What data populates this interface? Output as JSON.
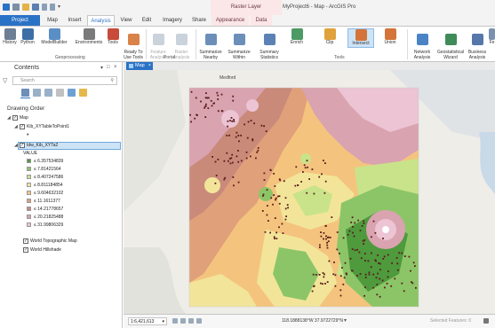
{
  "window": {
    "title": "MyProject6 - Map - ArcGIS Pro",
    "contextual_group": "Raster Layer"
  },
  "tabs": [
    {
      "label": "Project"
    },
    {
      "label": "Map"
    },
    {
      "label": "Insert"
    },
    {
      "label": "Analysis"
    },
    {
      "label": "View"
    },
    {
      "label": "Edit"
    },
    {
      "label": "Imagery"
    },
    {
      "label": "Share"
    },
    {
      "label": "Appearance"
    },
    {
      "label": "Data"
    }
  ],
  "ribbon": {
    "geoprocessing": {
      "label": "Geoprocessing",
      "buttons": [
        {
          "label": "History",
          "icon": "history-icon"
        },
        {
          "label": "Python",
          "icon": "python-icon"
        },
        {
          "label": "ModelBuilder",
          "icon": "modelbuilder-icon"
        },
        {
          "label": "Environments",
          "icon": "environments-icon"
        },
        {
          "label": "Tools",
          "icon": "toolbox-icon"
        },
        {
          "label": "Ready To\nUse Tools",
          "icon": "ready-tools-icon"
        }
      ]
    },
    "portal": {
      "label": "Portal",
      "buttons": [
        {
          "label": "Feature\nAnalysis",
          "icon": "feature-analysis-icon"
        },
        {
          "label": "Raster\nAnalysis",
          "icon": "raster-analysis-icon"
        }
      ]
    },
    "tools": {
      "label": "Tools",
      "buttons": [
        {
          "label": "Summarize\nNearby",
          "icon": "summarize-nearby-icon"
        },
        {
          "label": "Summarize\nWithin",
          "icon": "summarize-within-icon"
        },
        {
          "label": "Summary\nStatistics",
          "icon": "summary-statistics-icon"
        },
        {
          "label": "Enrich",
          "icon": "enrich-icon"
        },
        {
          "label": "Clip",
          "icon": "clip-icon"
        },
        {
          "label": "Intersect",
          "icon": "intersect-icon"
        },
        {
          "label": "Union",
          "icon": "union-icon"
        }
      ]
    },
    "extra": [
      {
        "label": "Network\nAnalysis",
        "icon": "network-analysis-icon"
      },
      {
        "label": "Geostatistical\nWizard",
        "icon": "geostatistical-wizard-icon"
      },
      {
        "label": "Business\nAnalysis",
        "icon": "business-analysis-icon"
      },
      {
        "label": "Fe",
        "icon": "feature-icon"
      }
    ]
  },
  "contents": {
    "title": "Contents",
    "search_placeholder": "Search",
    "drawing_order": "Drawing Order",
    "map_label": "Map",
    "layer1": "Kib_XYTableToPoint1",
    "layer2": "Idw_Kib_XYTa2",
    "value_label": "VALUE",
    "legend": [
      {
        "label": "≤ 6.357534839",
        "color": "#4e9a3d"
      },
      {
        "label": "≤ 7.81421564",
        "color": "#8cc567"
      },
      {
        "label": "≤ 8.407247586",
        "color": "#c9e38a"
      },
      {
        "label": "≤ 8.811184854",
        "color": "#f2e59a"
      },
      {
        "label": "≤ 9.604632102",
        "color": "#f4c47e"
      },
      {
        "label": "≤ 11.1611377",
        "color": "#e0a07a"
      },
      {
        "label": "≤ 14.21778657",
        "color": "#c98a7a"
      },
      {
        "label": "≤ 20.21825488",
        "color": "#d9a3b0"
      },
      {
        "label": "≤ 31.99806329",
        "color": "#ecc4d4"
      }
    ],
    "basemap1": "World Topographic Map",
    "basemap2": "World Hillshade"
  },
  "map": {
    "tab_label": "Map",
    "place_label": "Medford"
  },
  "status": {
    "scale": "1:6,421,613",
    "coordinates": "118.1888138°W 37.9722729°N",
    "selected_features": "Selected Features: 0"
  },
  "colors": {
    "project_tab": "#2a72c6",
    "accent": "#2a72c6",
    "contextual": "#fbe6e8",
    "point_symbol": "#5a1b1b"
  }
}
